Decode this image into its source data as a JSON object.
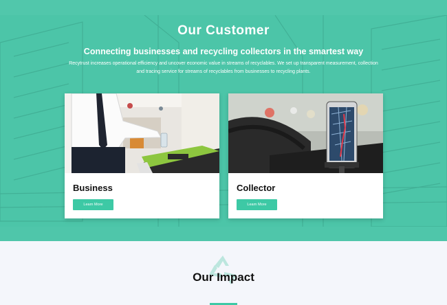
{
  "customer_section": {
    "title": "Our Customer",
    "subtitle": "Connecting businesses and recycling collectors in the smartest way",
    "description": "Recytrust increases operational efficiency and uncover economic value in streams of recyclables. We set up transparent measurement, collection and tracing service for streams of recyclables from businesses to recycling plants.",
    "background_color": "#4cc5a8"
  },
  "cards": [
    {
      "title": "Business",
      "button_label": "Learn More",
      "image": "person-recycling-bottle-photo"
    },
    {
      "title": "Collector",
      "button_label": "Learn More",
      "image": "phone-navigation-in-car-photo"
    }
  ],
  "impact_section": {
    "title": "Our Impact",
    "icon": "recycle-icon"
  },
  "colors": {
    "accent": "#3dc9a5",
    "page_background": "#f4f6fb"
  }
}
